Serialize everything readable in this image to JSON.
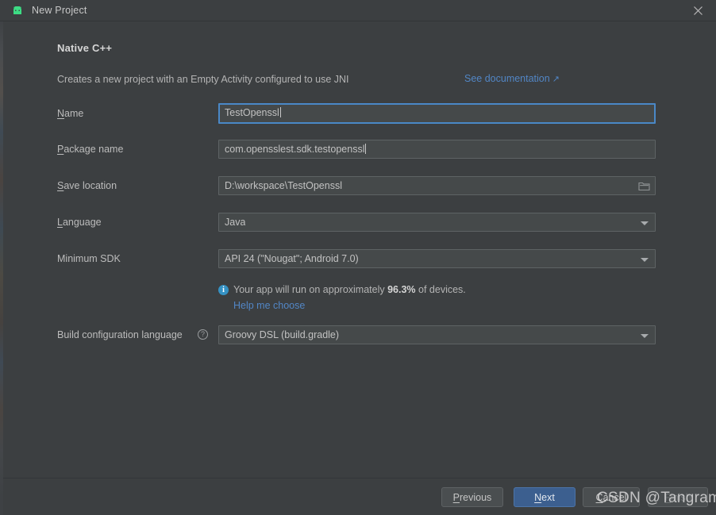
{
  "window": {
    "title": "New Project",
    "app_icon": "android-robot-icon",
    "close_icon": "close-icon"
  },
  "wizard": {
    "step_title": "Native C++",
    "step_description": "Creates a new project with an Empty Activity configured to use JNI",
    "documentation_link": "See documentation",
    "documentation_link_arrow": "↗"
  },
  "form": {
    "rows": [
      {
        "label_prefix": "",
        "mnemonic": "N",
        "label_suffix": "ame",
        "value": "TestOpenssl",
        "kind": "text",
        "focused": true
      },
      {
        "label_prefix": "",
        "mnemonic": "P",
        "label_suffix": "ackage name",
        "value": "com.opensslest.sdk.testopenssl",
        "kind": "text",
        "focused": false
      },
      {
        "label_prefix": "",
        "mnemonic": "S",
        "label_suffix": "ave location",
        "value": "D:\\workspace\\TestOpenssl",
        "kind": "path",
        "focused": false
      },
      {
        "label_prefix": "",
        "mnemonic": "L",
        "label_suffix": "anguage",
        "value": "Java",
        "kind": "combo",
        "focused": false
      },
      {
        "label_prefix": "Minimum SDK",
        "mnemonic": "",
        "label_suffix": "",
        "value": "API 24 (\"Nougat\"; Android 7.0)",
        "kind": "combo",
        "focused": false
      }
    ],
    "build_config": {
      "label": "Build configuration language",
      "help_icon": "?",
      "value": "Groovy DSL (build.gradle)"
    }
  },
  "device_info": {
    "icon": "info-icon",
    "icon_glyph": "i",
    "text_before": "Your app will run on approximately ",
    "percent": "96.3%",
    "text_after": " of devices.",
    "help_link": "Help me choose"
  },
  "buttons": {
    "previous": {
      "prefix": "",
      "mnemonic": "P",
      "suffix": "revious"
    },
    "next": {
      "prefix": "",
      "mnemonic": "N",
      "suffix": "ext"
    },
    "cancel": {
      "prefix": "",
      "mnemonic": "C",
      "suffix": "ancel"
    },
    "finish": {
      "prefix": "",
      "mnemonic": "F",
      "suffix": "inish",
      "disabled": true
    }
  },
  "watermark": "CSDN @Tangramor",
  "colors": {
    "window_bg": "#3c3f41",
    "field_bg": "#45494a",
    "field_border": "#5e6364",
    "focus_border": "#4a88c7",
    "accent_link": "#5286c5",
    "primary_button": "#3c5f8f",
    "info_blue": "#3592c4",
    "android_green": "#3ddc84"
  }
}
